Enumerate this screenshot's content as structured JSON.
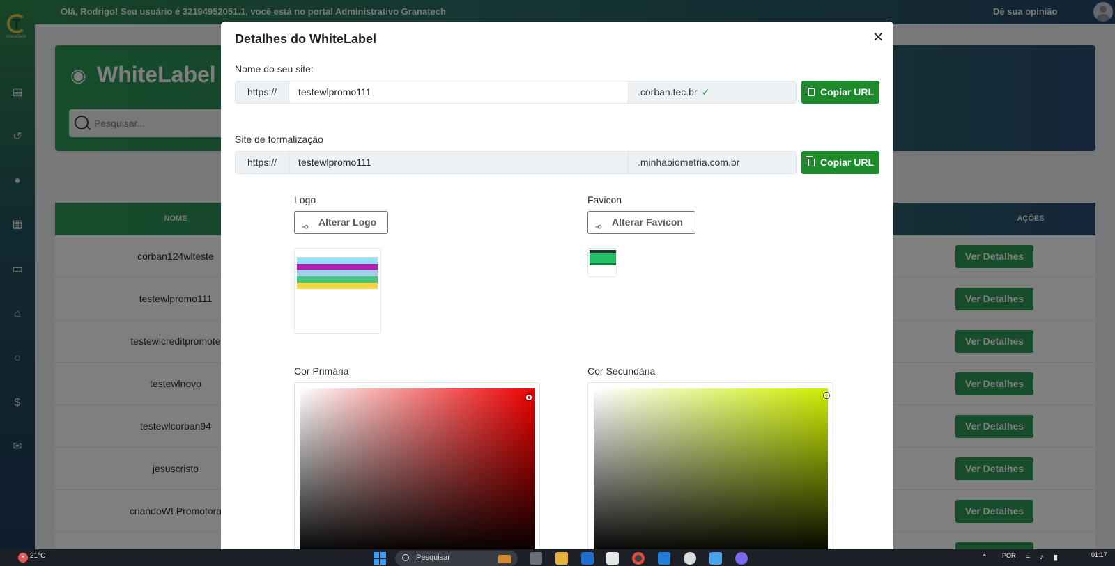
{
  "topbar": {
    "greeting": "Olá, Rodrigo! Seu usuário é 32194952051.1, você está no portal Administrativo Granatech",
    "feedback": "Dê sua opinião"
  },
  "sidebar": {
    "logo_text": "GranaTech",
    "icons": [
      "document-icon",
      "history-icon",
      "palette-icon",
      "apps-icon",
      "clipboard-icon",
      "bank-icon",
      "user-icon",
      "dollar-icon",
      "feedback-icon"
    ]
  },
  "page": {
    "title": "WhiteLabel",
    "search_placeholder": "Pesquisar..."
  },
  "table": {
    "col_name": "NOME",
    "col_actions": "AÇÕES",
    "action_label": "Ver Detalhes",
    "rows": [
      "corban124wlteste",
      "testewlpromo111",
      "testewlcreditpromote",
      "testewlnovo",
      "testewlcorban94",
      "jesuscristo",
      "criandoWLPromotora"
    ]
  },
  "modal": {
    "title": "Detalhes do WhiteLabel",
    "site_name_label": "Nome do seu site:",
    "site_prefix": "https://",
    "site_value": "testewlpromo111",
    "site_suffix": ".corban.tec.br",
    "copy_label": "Copiar URL",
    "formalization_label": "Site de formalização",
    "form_prefix": "https://",
    "form_value": "testewlpromo111",
    "form_suffix": ".minhabiometria.com.br",
    "logo_label": "Logo",
    "change_logo": "Alterar Logo",
    "favicon_label": "Favicon",
    "change_favicon": "Alterar Favicon",
    "primary_color_label": "Cor Primária",
    "secondary_color_label": "Cor Secundária",
    "primary_hue": "#ee0000",
    "secondary_hue": "#ccee00"
  },
  "taskbar": {
    "temperature": "21°C",
    "search_placeholder": "Pesquisar",
    "language": "POR",
    "time": "01:17"
  }
}
